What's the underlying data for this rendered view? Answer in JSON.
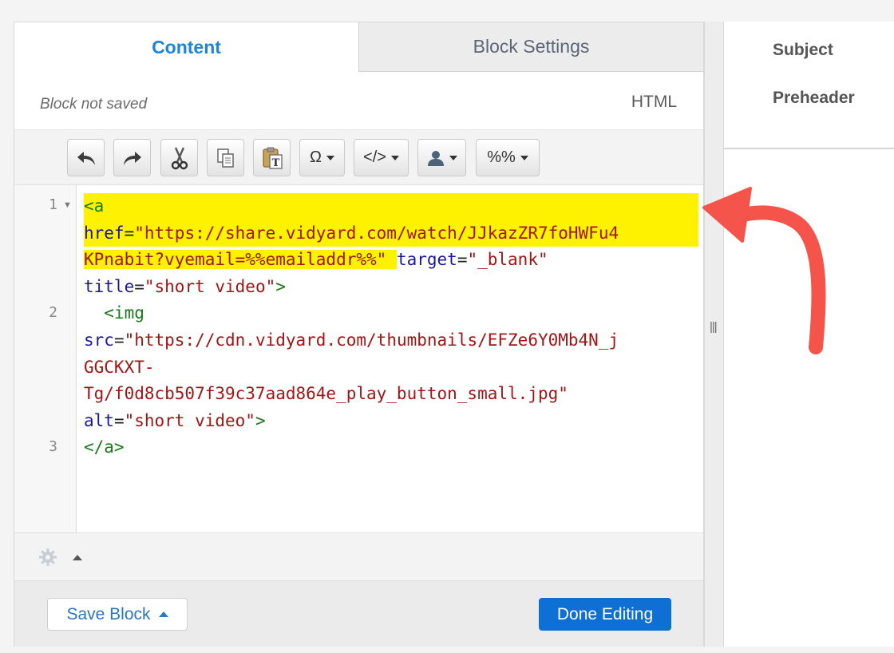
{
  "tabs": {
    "content": "Content",
    "block_settings": "Block Settings"
  },
  "status": {
    "block_state": "Block not saved",
    "mode": "HTML"
  },
  "toolbar": {
    "undo_icon": "undo-arrow-icon",
    "redo_icon": "redo-arrow-icon",
    "cut_icon": "scissors-icon",
    "copy_icon": "copy-icon",
    "paste_text_icon": "paste-text-icon",
    "special_char_label": "Ω",
    "source_label": "</>",
    "personalize_icon": "person-icon",
    "merge_label": "%%"
  },
  "editor": {
    "line_numbers": [
      "1",
      "2",
      "3"
    ],
    "lines": [
      "<a",
      "href=\"https://share.vidyard.com/watch/JJkazZR7foHWFu4",
      "KPnabit?vyemail=%%emailaddr%%\" target=\"_blank\"",
      "title=\"short video\">",
      "  <img",
      "src=\"https://cdn.vidyard.com/thumbnails/EFZe6Y0Mb4N_j",
      "GGCKXT-",
      "Tg/f0d8cb507f39c37aad864e_play_button_small.jpg\"",
      "alt=\"short video\">",
      "</a>"
    ]
  },
  "actions": {
    "save_block": "Save Block",
    "done_editing": "Done Editing"
  },
  "right_panel": {
    "subject_label": "Subject",
    "preheader_label": "Preheader"
  },
  "colors": {
    "accent_blue": "#1a86d9",
    "primary_button": "#0e6fd4",
    "highlight_yellow": "#fff200",
    "arrow_red": "#f5544a",
    "code_tag": "#1a7a1a",
    "code_attr": "#1818a0",
    "code_string": "#a31515"
  }
}
